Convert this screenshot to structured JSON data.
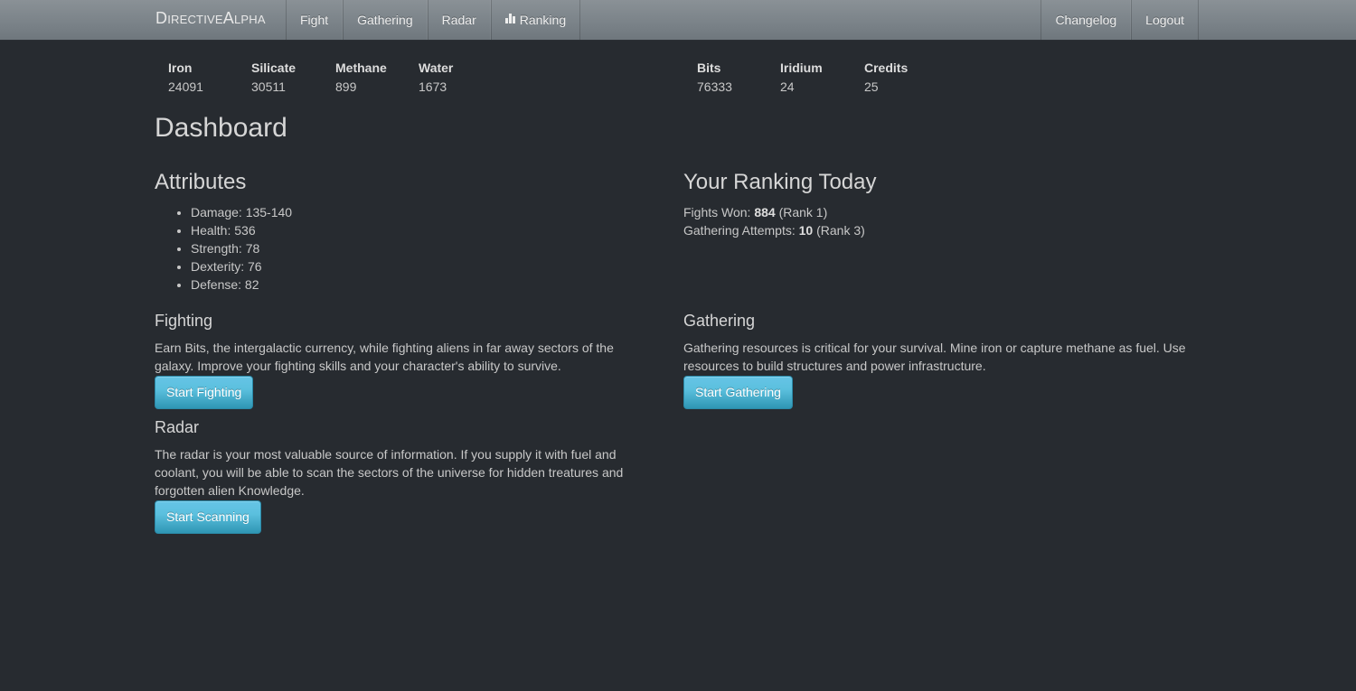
{
  "nav": {
    "brand": "DirectiveAlpha",
    "left": [
      {
        "label": "Fight"
      },
      {
        "label": "Gathering"
      },
      {
        "label": "Radar"
      },
      {
        "label": "Ranking",
        "icon": "bar-chart-icon"
      }
    ],
    "right": [
      {
        "label": "Changelog"
      },
      {
        "label": "Logout"
      }
    ]
  },
  "resources": [
    {
      "label": "Iron",
      "value": "24091"
    },
    {
      "label": "Silicate",
      "value": "30511"
    },
    {
      "label": "Methane",
      "value": "899"
    },
    {
      "label": "Water",
      "value": "1673"
    },
    {
      "label": "Bits",
      "value": "76333"
    },
    {
      "label": "Iridium",
      "value": "24"
    },
    {
      "label": "Credits",
      "value": "25"
    }
  ],
  "page_title": "Dashboard",
  "attributes": {
    "title": "Attributes",
    "items": [
      "Damage: 135-140",
      "Health: 536",
      "Strength: 78",
      "Dexterity: 76",
      "Defense: 82"
    ]
  },
  "ranking": {
    "title": "Your Ranking Today",
    "fights_label": "Fights Won: ",
    "fights_value": "884",
    "fights_rank": " (Rank 1)",
    "gathering_label": "Gathering Attempts: ",
    "gathering_value": "10",
    "gathering_rank": " (Rank 3)"
  },
  "fighting": {
    "title": "Fighting",
    "text": "Earn Bits, the intergalactic currency, while fighting aliens in far away sectors of the galaxy. Improve your fighting skills and your character's ability to survive.",
    "button": "Start Fighting"
  },
  "gathering": {
    "title": "Gathering",
    "text": "Gathering resources is critical for your survival. Mine iron or capture methane as fuel. Use resources to build structures and power infrastructure.",
    "button": "Start Gathering"
  },
  "radar": {
    "title": "Radar",
    "text": "The radar is your most valuable source of information. If you supply it with fuel and coolant, you will be able to scan the sectors of the universe for hidden treatures and forgotten alien Knowledge.",
    "button": "Start Scanning"
  }
}
